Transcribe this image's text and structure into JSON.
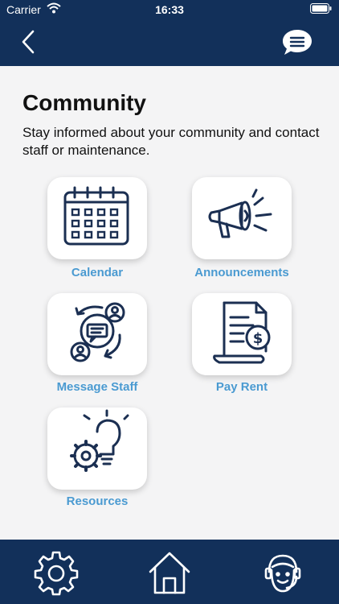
{
  "status_bar": {
    "carrier": "Carrier",
    "time": "16:33"
  },
  "page": {
    "title": "Community",
    "subtitle": "Stay informed about your community and contact staff or maintenance."
  },
  "tiles": [
    {
      "label": "Calendar",
      "icon": "calendar-icon"
    },
    {
      "label": "Announcements",
      "icon": "megaphone-icon"
    },
    {
      "label": "Message Staff",
      "icon": "message-staff-icon"
    },
    {
      "label": "Pay Rent",
      "icon": "invoice-dollar-icon"
    },
    {
      "label": "Resources",
      "icon": "lightbulb-gear-icon"
    }
  ],
  "tab_bar": {
    "icons": [
      "gear-icon",
      "home-icon",
      "support-agent-icon"
    ]
  },
  "colors": {
    "navy": "#12305a",
    "accent": "#4a9ad1",
    "icon_stroke": "#1b2f52",
    "background": "#f4f4f5"
  }
}
